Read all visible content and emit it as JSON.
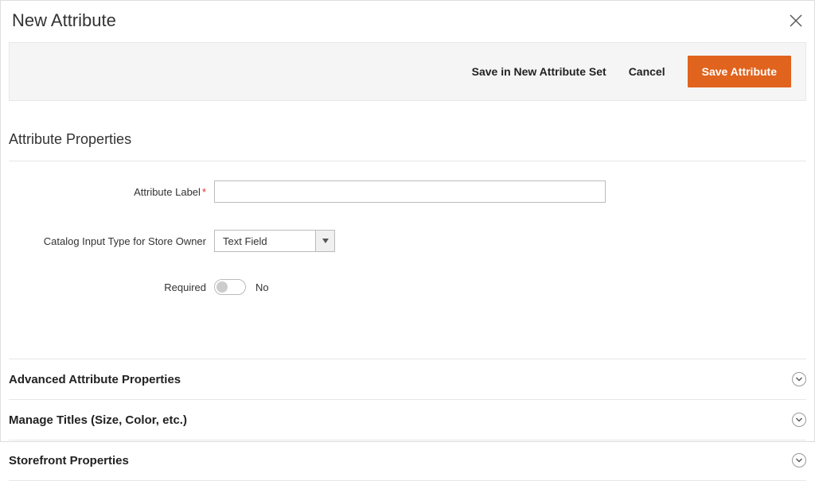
{
  "header": {
    "title": "New Attribute"
  },
  "actions": {
    "save_in_set": "Save in New Attribute Set",
    "cancel": "Cancel",
    "save": "Save Attribute"
  },
  "section": {
    "title": "Attribute Properties"
  },
  "form": {
    "attribute_label": {
      "label": "Attribute Label",
      "value": ""
    },
    "input_type": {
      "label": "Catalog Input Type for Store Owner",
      "value": "Text Field"
    },
    "required": {
      "label": "Required",
      "value": "No"
    }
  },
  "collapsibles": [
    {
      "title": "Advanced Attribute Properties"
    },
    {
      "title": "Manage Titles (Size, Color, etc.)"
    },
    {
      "title": "Storefront Properties"
    }
  ]
}
